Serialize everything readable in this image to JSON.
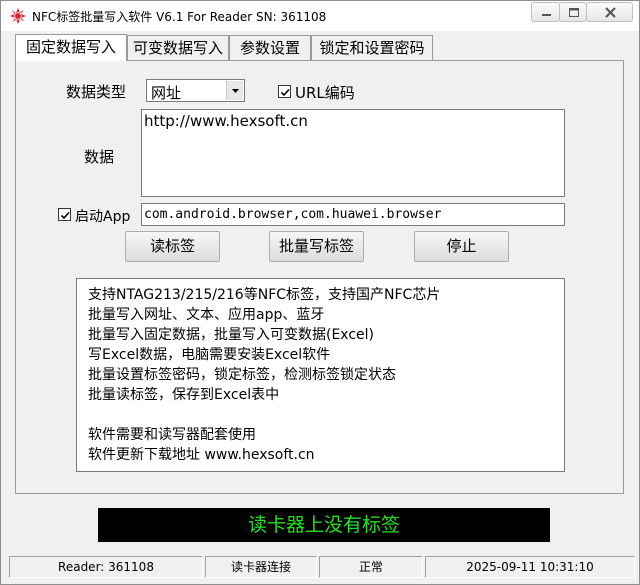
{
  "window": {
    "title": "NFC标签批量写入软件 V6.1 For Reader  SN:  361108"
  },
  "tabs": [
    {
      "label": "固定数据写入",
      "active": true
    },
    {
      "label": "可变数据写入",
      "active": false
    },
    {
      "label": "参数设置",
      "active": false
    },
    {
      "label": "锁定和设置密码",
      "active": false
    }
  ],
  "form": {
    "data_type_label": "数据类型",
    "data_type_value": "网址",
    "url_encode_label": "URL编码",
    "url_encode_checked": true,
    "data_label": "数据",
    "data_value": "http://www.hexsoft.cn",
    "launch_app_label": "启动App",
    "launch_app_checked": true,
    "app_value": "com.android.browser,com.huawei.browser"
  },
  "buttons": {
    "read": "读标签",
    "batch_write": "批量写标签",
    "stop": "停止"
  },
  "info_lines": [
    "支持NTAG213/215/216等NFC标签，支持国产NFC芯片",
    "批量写入网址、文本、应用app、蓝牙",
    "批量写入固定数据，批量写入可变数据(Excel)",
    "写Excel数据，电脑需要安装Excel软件",
    "批量设置标签密码，锁定标签，检测标签锁定状态",
    "批量读标签，保存到Excel表中",
    "",
    "软件需要和读写器配套使用",
    "软件更新下载地址 www.hexsoft.cn"
  ],
  "status_banner": "读卡器上没有标签",
  "statusbar": {
    "reader": "Reader: 361108",
    "connection": "读卡器连接",
    "state": "正常",
    "datetime": "2025-09-11 10:31:10"
  },
  "colors": {
    "banner_bg": "#000000",
    "banner_text": "#1ee21e",
    "window_bg": "#f0f0f0"
  },
  "icons": {
    "app": "nfc-app-icon",
    "minimize": "minimize-icon",
    "maximize": "maximize-icon",
    "close": "close-icon",
    "dropdown": "chevron-down-icon",
    "check": "check-icon"
  }
}
